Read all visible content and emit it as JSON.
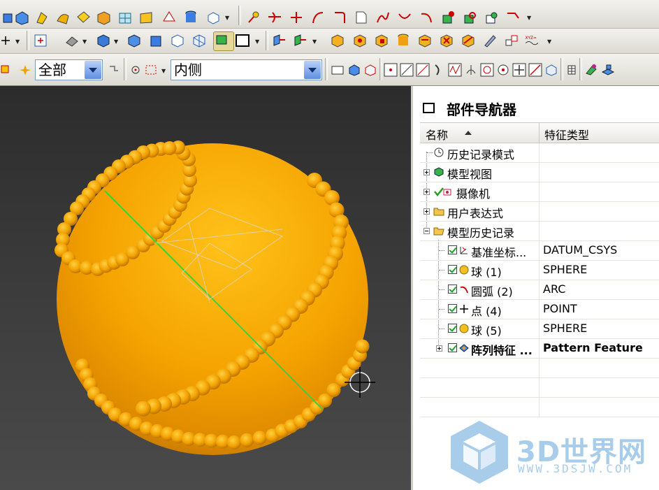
{
  "toolbar": {
    "filter_combo_value": "全部",
    "scope_combo_value": "内侧"
  },
  "navigator": {
    "title": "部件导航器",
    "columns": {
      "name": "名称",
      "type": "特征类型"
    },
    "rows": [
      {
        "name": "历史记录模式",
        "type": ""
      },
      {
        "name": "模型视图",
        "type": ""
      },
      {
        "name": "摄像机",
        "type": ""
      },
      {
        "name": "用户表达式",
        "type": ""
      },
      {
        "name": "模型历史记录",
        "type": ""
      },
      {
        "name": "基准坐标...",
        "type": "DATUM_CSYS"
      },
      {
        "name": "球 (1)",
        "type": "SPHERE"
      },
      {
        "name": "圆弧 (2)",
        "type": "ARC"
      },
      {
        "name": "点 (4)",
        "type": "POINT"
      },
      {
        "name": "球 (5)",
        "type": "SPHERE"
      },
      {
        "name": "阵列特征 ...",
        "type": "Pattern Feature"
      }
    ]
  },
  "watermark": {
    "title": "3D世界网",
    "url": "WWW.3DSJW.COM"
  },
  "colors": {
    "sphere": "#f5a600",
    "bead": "#f2a100",
    "axis": "#3ad13a",
    "combo_drop": "#5f8fe0"
  }
}
